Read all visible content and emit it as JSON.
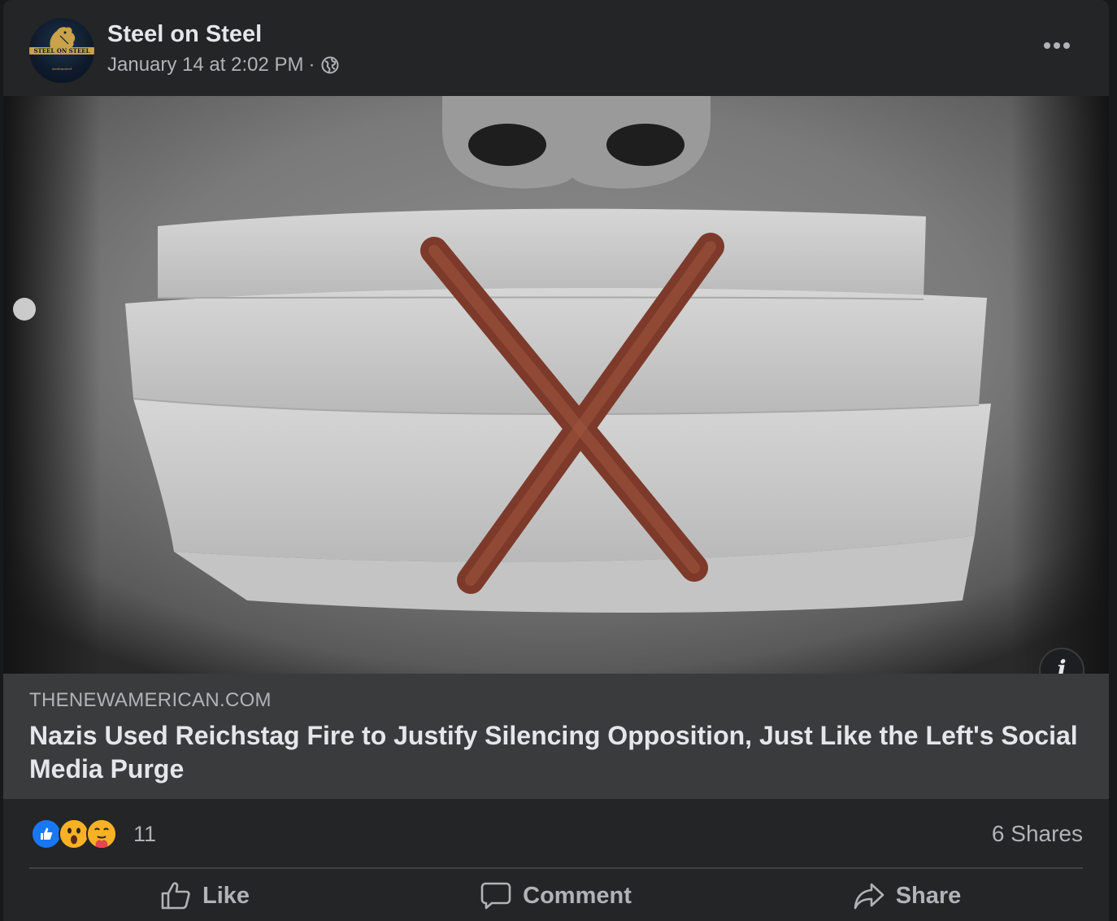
{
  "post": {
    "page_name": "Steel on Steel",
    "timestamp": "January 14 at 2:02 PM",
    "separator": "·",
    "audience_icon": "globe-icon",
    "more_icon": "more-dots-icon",
    "avatar": {
      "band_text": "STEEL ON STEEL",
      "small_text": "steelonsteel",
      "colors": {
        "background": "#0e1a2a",
        "gold": "#c9a24a"
      }
    }
  },
  "link_preview": {
    "domain": "THENEWAMERICAN.COM",
    "title": "Nazis Used Reichstag Fire to Justify Silencing Opposition, Just Like the Left's Social Media Purge",
    "info_label": "i"
  },
  "engagement": {
    "reactions": [
      "like",
      "wow",
      "care"
    ],
    "reaction_count": "11",
    "shares": "6 Shares"
  },
  "actions": {
    "like": "Like",
    "comment": "Comment",
    "share": "Share"
  },
  "colors": {
    "card_background": "#242526",
    "page_background": "#18191a",
    "preview_background": "#3a3b3c",
    "primary_text": "#e4e6eb",
    "secondary_text": "#b0b3b8",
    "like_blue": "#1877f2",
    "wow_yellow": "#f7b125"
  }
}
